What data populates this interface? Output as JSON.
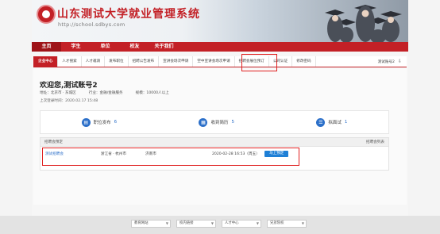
{
  "header": {
    "site_title": "山东测试大学就业管理系统",
    "site_url": "http://school.sdbys.com"
  },
  "topnav": {
    "items": [
      "主页",
      "学生",
      "单位",
      "校友",
      "关于我们"
    ]
  },
  "subnav": {
    "items": [
      "企业中心",
      "人才搜索",
      "人才邀请",
      "发布职位",
      "招聘公告发布",
      "宣讲会场次申请",
      "空中宣讲会场次申请",
      "招聘会展位预订",
      "公司认证",
      "修改密码"
    ],
    "active_index": 0,
    "highlighted_index": 7,
    "user_label": "测试账号2",
    "user_arrow": "⇩"
  },
  "welcome": {
    "title": "欢迎您,测试账号2",
    "address": "地址：北京市 · 东城区",
    "industry": "行业：金融/金融服务",
    "scale": "规模：10000人以上",
    "last_login": "上次登录时间：2020.02.17 15:48"
  },
  "stats": [
    {
      "icon": "job-icon",
      "glyph": "▤",
      "label": "职位发布",
      "value": "6"
    },
    {
      "icon": "resume-icon",
      "glyph": "▦",
      "label": "收到简历",
      "value": "5"
    },
    {
      "icon": "interview-icon",
      "glyph": "☰",
      "label": "拟面试",
      "value": "1"
    }
  ],
  "panel": {
    "title": "招聘会预定",
    "more": "招聘会列表",
    "row": {
      "name": "测试招聘会",
      "province": "浙江省 · 杭州市",
      "city": "济南市",
      "datetime": "2020-02-28 16:53（周五）",
      "button": "马上预定"
    }
  },
  "footer": {
    "selects": [
      "教育网站",
      "校内链接",
      "人才中心",
      "兄弟院校"
    ]
  },
  "colors": {
    "brand_red": "#c32026",
    "highlight_red": "#e02020",
    "link_blue": "#2b6fc9",
    "button_blue": "#1e7fd6"
  }
}
